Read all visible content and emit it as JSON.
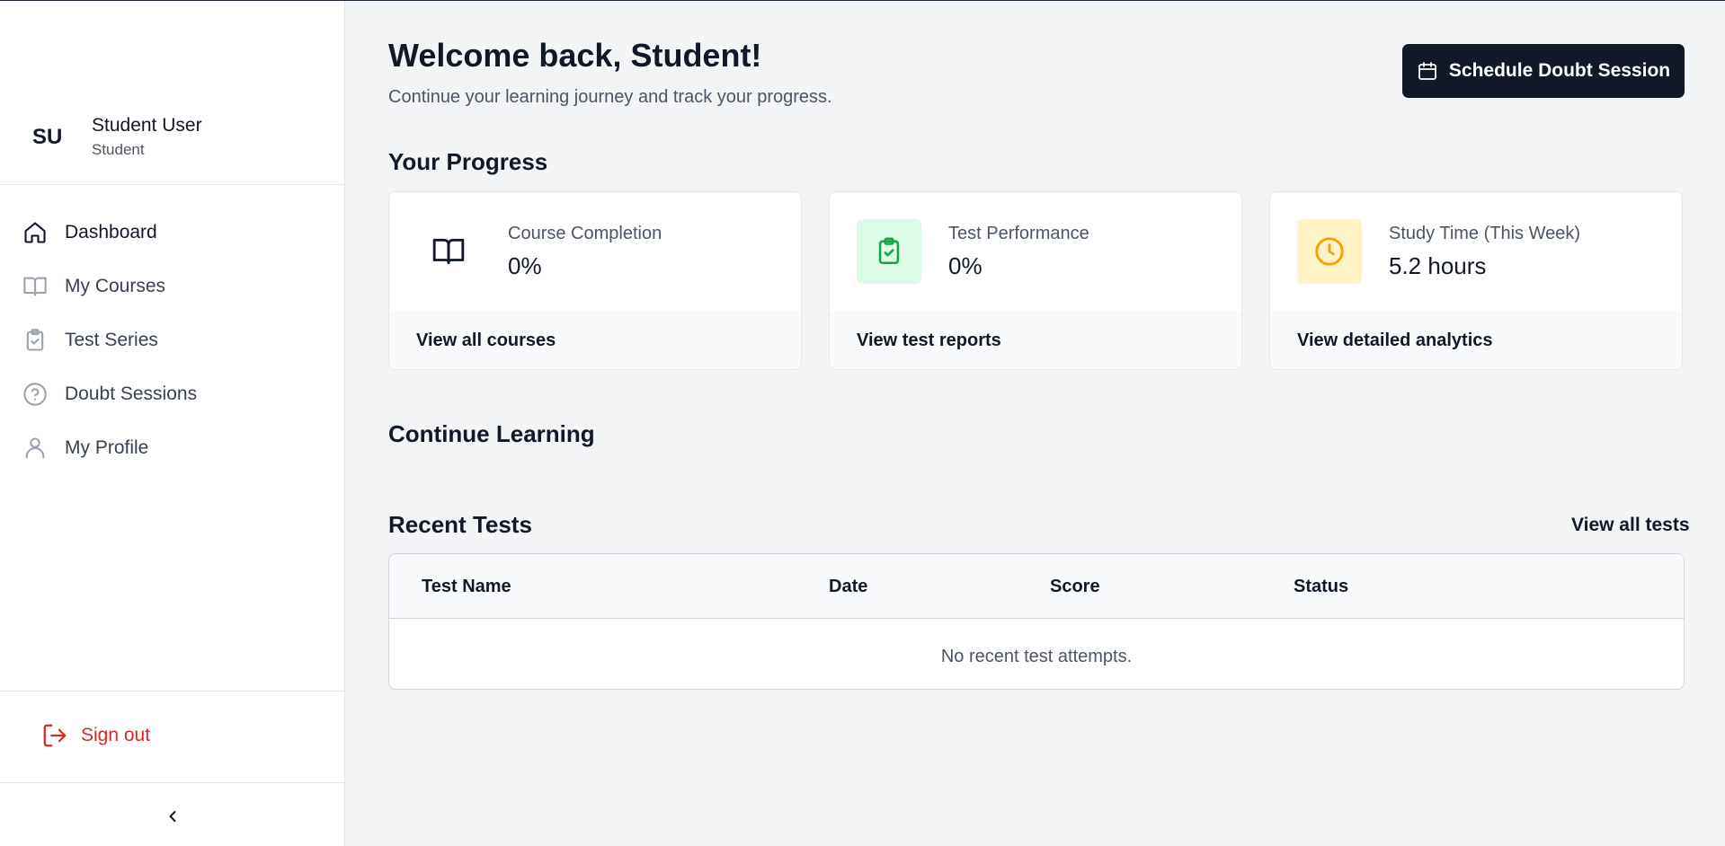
{
  "user": {
    "initials": "SU",
    "name": "Student User",
    "role": "Student"
  },
  "nav": [
    {
      "label": "Dashboard",
      "icon": "home-icon",
      "active": true
    },
    {
      "label": "My Courses",
      "icon": "book-icon"
    },
    {
      "label": "Test Series",
      "icon": "clipboard-check-icon"
    },
    {
      "label": "Doubt Sessions",
      "icon": "question-circle-icon"
    },
    {
      "label": "My Profile",
      "icon": "user-icon"
    }
  ],
  "sign_out": {
    "label": "Sign out",
    "icon": "logout-icon",
    "color": "#dc2626"
  },
  "header": {
    "title": "Welcome back, Student!",
    "subtitle": "Continue your learning journey and track your progress.",
    "schedule_button": "Schedule Doubt Session"
  },
  "progress": {
    "title": "Your Progress",
    "cards": [
      {
        "label": "Course Completion",
        "value": "0%",
        "link": "View all courses",
        "icon": "book-icon",
        "icon_bg": "#ffffff",
        "icon_color": "#111827"
      },
      {
        "label": "Test Performance",
        "value": "0%",
        "link": "View test reports",
        "icon": "clipboard-check-icon",
        "icon_bg": "#dcfce7",
        "icon_color": "#16a34a"
      },
      {
        "label": "Study Time (This Week)",
        "value": "5.2 hours",
        "link": "View detailed analytics",
        "icon": "clock-icon",
        "icon_bg": "#fef3c7",
        "icon_color": "#f59e0b"
      }
    ]
  },
  "continue_learning": {
    "title": "Continue Learning"
  },
  "recent_tests": {
    "title": "Recent Tests",
    "view_all": "View all tests",
    "columns": [
      "Test Name",
      "Date",
      "Score",
      "Status"
    ],
    "empty_message": "No recent test attempts."
  },
  "colors": {
    "dark": "#111827",
    "background": "#f3f4f6",
    "danger": "#dc2626"
  }
}
